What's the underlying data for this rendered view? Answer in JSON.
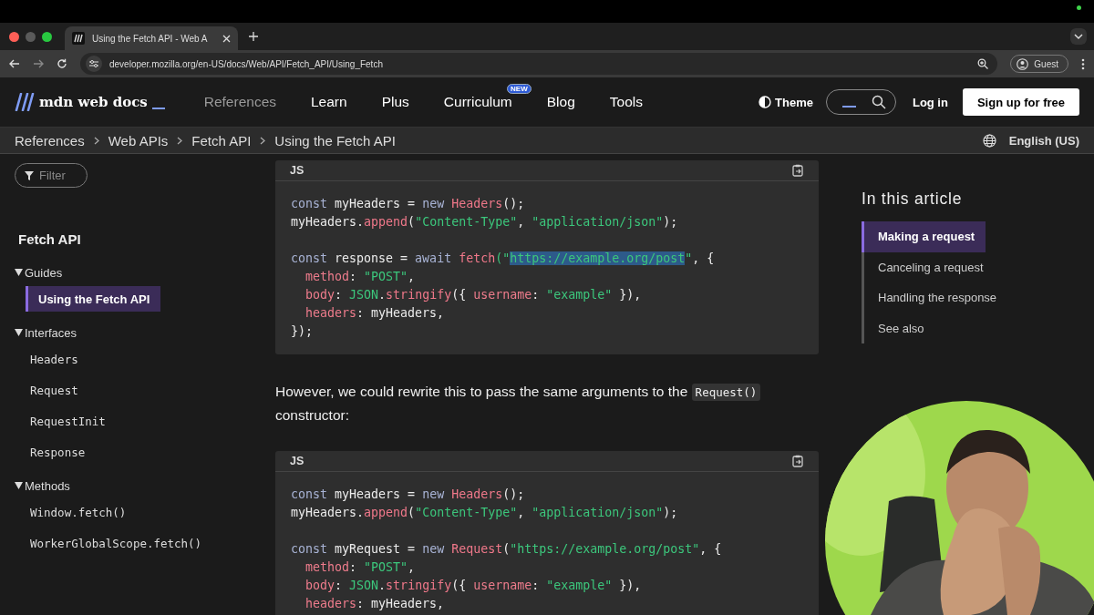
{
  "browser": {
    "tab_title": "Using the Fetch API - Web A",
    "url": "developer.mozilla.org/en-US/docs/Web/API/Fetch_API/Using_Fetch",
    "profile": "Guest"
  },
  "header": {
    "logo": "mdn web docs",
    "nav": [
      {
        "label": "References",
        "selected": true
      },
      {
        "label": "Learn",
        "selected": false
      },
      {
        "label": "Plus",
        "selected": false
      },
      {
        "label": "Curriculum",
        "selected": false,
        "badge": "NEW"
      },
      {
        "label": "Blog",
        "selected": false
      },
      {
        "label": "Tools",
        "selected": false
      }
    ],
    "theme": "Theme",
    "login": "Log in",
    "signup": "Sign up for free"
  },
  "breadcrumbs": [
    "References",
    "Web APIs",
    "Fetch API",
    "Using the Fetch API"
  ],
  "language": "English (US)",
  "sidebar": {
    "filter_placeholder": "Filter",
    "title": "Fetch API",
    "sections": [
      {
        "label": "Guides",
        "expanded": true,
        "items": [
          {
            "label": "Using the Fetch API",
            "kind": "text",
            "selected": true
          }
        ]
      },
      {
        "label": "Interfaces",
        "expanded": true,
        "items": [
          {
            "label": "Headers",
            "kind": "code",
            "selected": false
          },
          {
            "label": "Request",
            "kind": "code",
            "selected": false
          },
          {
            "label": "RequestInit",
            "kind": "code",
            "selected": false
          },
          {
            "label": "Response",
            "kind": "code",
            "selected": false
          }
        ]
      },
      {
        "label": "Methods",
        "expanded": true,
        "items": [
          {
            "label": "Window.fetch()",
            "kind": "code",
            "selected": false
          },
          {
            "label": "WorkerGlobalScope.fetch()",
            "kind": "code",
            "selected": false
          }
        ]
      }
    ]
  },
  "content": [
    {
      "kind": "code",
      "language": "JS",
      "groups": [
        [
          [
            {
              "text": "const ",
              "kind": "kw"
            },
            {
              "text": "myHeaders = ",
              "kind": "id"
            },
            {
              "text": "new ",
              "kind": "kw"
            },
            {
              "text": "Headers",
              "kind": "fn"
            },
            {
              "text": "();",
              "kind": "id"
            }
          ],
          [
            {
              "text": "myHeaders.",
              "kind": "id"
            },
            {
              "text": "append",
              "kind": "fn"
            },
            {
              "text": "(",
              "kind": "id"
            },
            {
              "text": "\"Content-Type\"",
              "kind": "str"
            },
            {
              "text": ", ",
              "kind": "id"
            },
            {
              "text": "\"application/json\"",
              "kind": "str"
            },
            {
              "text": ");",
              "kind": "id"
            }
          ]
        ],
        [
          [
            {
              "text": "const ",
              "kind": "kw"
            },
            {
              "text": "response = ",
              "kind": "id"
            },
            {
              "text": "await ",
              "kind": "kw"
            },
            {
              "text": "fetch",
              "kind": "fn"
            },
            {
              "text": "(\"",
              "kind": "str"
            },
            {
              "text": "https://example.org/post",
              "kind": "selected"
            },
            {
              "text": "\"",
              "kind": "str"
            },
            {
              "text": ", {",
              "kind": "id"
            }
          ],
          [
            {
              "text": "  method",
              "kind": "prop"
            },
            {
              "text": ": ",
              "kind": "id"
            },
            {
              "text": "\"POST\"",
              "kind": "str"
            },
            {
              "text": ",",
              "kind": "id"
            }
          ],
          [
            {
              "text": "  body",
              "kind": "prop"
            },
            {
              "text": ": ",
              "kind": "id"
            },
            {
              "text": "JSON",
              "kind": "str"
            },
            {
              "text": ".",
              "kind": "id"
            },
            {
              "text": "stringify",
              "kind": "fn"
            },
            {
              "text": "({ ",
              "kind": "id"
            },
            {
              "text": "username",
              "kind": "prop"
            },
            {
              "text": ": ",
              "kind": "id"
            },
            {
              "text": "\"example\"",
              "kind": "str"
            },
            {
              "text": " }),",
              "kind": "id"
            }
          ],
          [
            {
              "text": "  headers",
              "kind": "prop"
            },
            {
              "text": ": myHeaders,",
              "kind": "id"
            }
          ],
          [
            {
              "text": "});",
              "kind": "id"
            }
          ]
        ]
      ]
    },
    {
      "kind": "paragraph",
      "segments": [
        {
          "text": "However, we could rewrite this to pass the same arguments to the ",
          "kind": "text"
        },
        {
          "text": "Request()",
          "kind": "code"
        },
        {
          "text": " constructor:",
          "kind": "text"
        }
      ]
    },
    {
      "kind": "code",
      "language": "JS",
      "groups": [
        [
          [
            {
              "text": "const ",
              "kind": "kw"
            },
            {
              "text": "myHeaders = ",
              "kind": "id"
            },
            {
              "text": "new ",
              "kind": "kw"
            },
            {
              "text": "Headers",
              "kind": "fn"
            },
            {
              "text": "();",
              "kind": "id"
            }
          ],
          [
            {
              "text": "myHeaders.",
              "kind": "id"
            },
            {
              "text": "append",
              "kind": "fn"
            },
            {
              "text": "(",
              "kind": "id"
            },
            {
              "text": "\"Content-Type\"",
              "kind": "str"
            },
            {
              "text": ", ",
              "kind": "id"
            },
            {
              "text": "\"application/json\"",
              "kind": "str"
            },
            {
              "text": ");",
              "kind": "id"
            }
          ]
        ],
        [
          [
            {
              "text": "const ",
              "kind": "kw"
            },
            {
              "text": "myRequest = ",
              "kind": "id"
            },
            {
              "text": "new ",
              "kind": "kw"
            },
            {
              "text": "Request",
              "kind": "fn"
            },
            {
              "text": "(",
              "kind": "id"
            },
            {
              "text": "\"https://example.org/post\"",
              "kind": "str"
            },
            {
              "text": ", {",
              "kind": "id"
            }
          ],
          [
            {
              "text": "  method",
              "kind": "prop"
            },
            {
              "text": ": ",
              "kind": "id"
            },
            {
              "text": "\"POST\"",
              "kind": "str"
            },
            {
              "text": ",",
              "kind": "id"
            }
          ],
          [
            {
              "text": "  body",
              "kind": "prop"
            },
            {
              "text": ": ",
              "kind": "id"
            },
            {
              "text": "JSON",
              "kind": "str"
            },
            {
              "text": ".",
              "kind": "id"
            },
            {
              "text": "stringify",
              "kind": "fn"
            },
            {
              "text": "({ ",
              "kind": "id"
            },
            {
              "text": "username",
              "kind": "prop"
            },
            {
              "text": ": ",
              "kind": "id"
            },
            {
              "text": "\"example\"",
              "kind": "str"
            },
            {
              "text": " }),",
              "kind": "id"
            }
          ],
          [
            {
              "text": "  headers",
              "kind": "prop"
            },
            {
              "text": ": myHeaders,",
              "kind": "id"
            }
          ]
        ]
      ]
    }
  ],
  "toc": {
    "title": "In this article",
    "items": [
      {
        "label": "Making a request",
        "selected": true
      },
      {
        "label": "Canceling a request",
        "selected": false
      },
      {
        "label": "Handling the response",
        "selected": false
      },
      {
        "label": "See also",
        "selected": false
      }
    ]
  },
  "webcam": {
    "kind": "picture"
  }
}
